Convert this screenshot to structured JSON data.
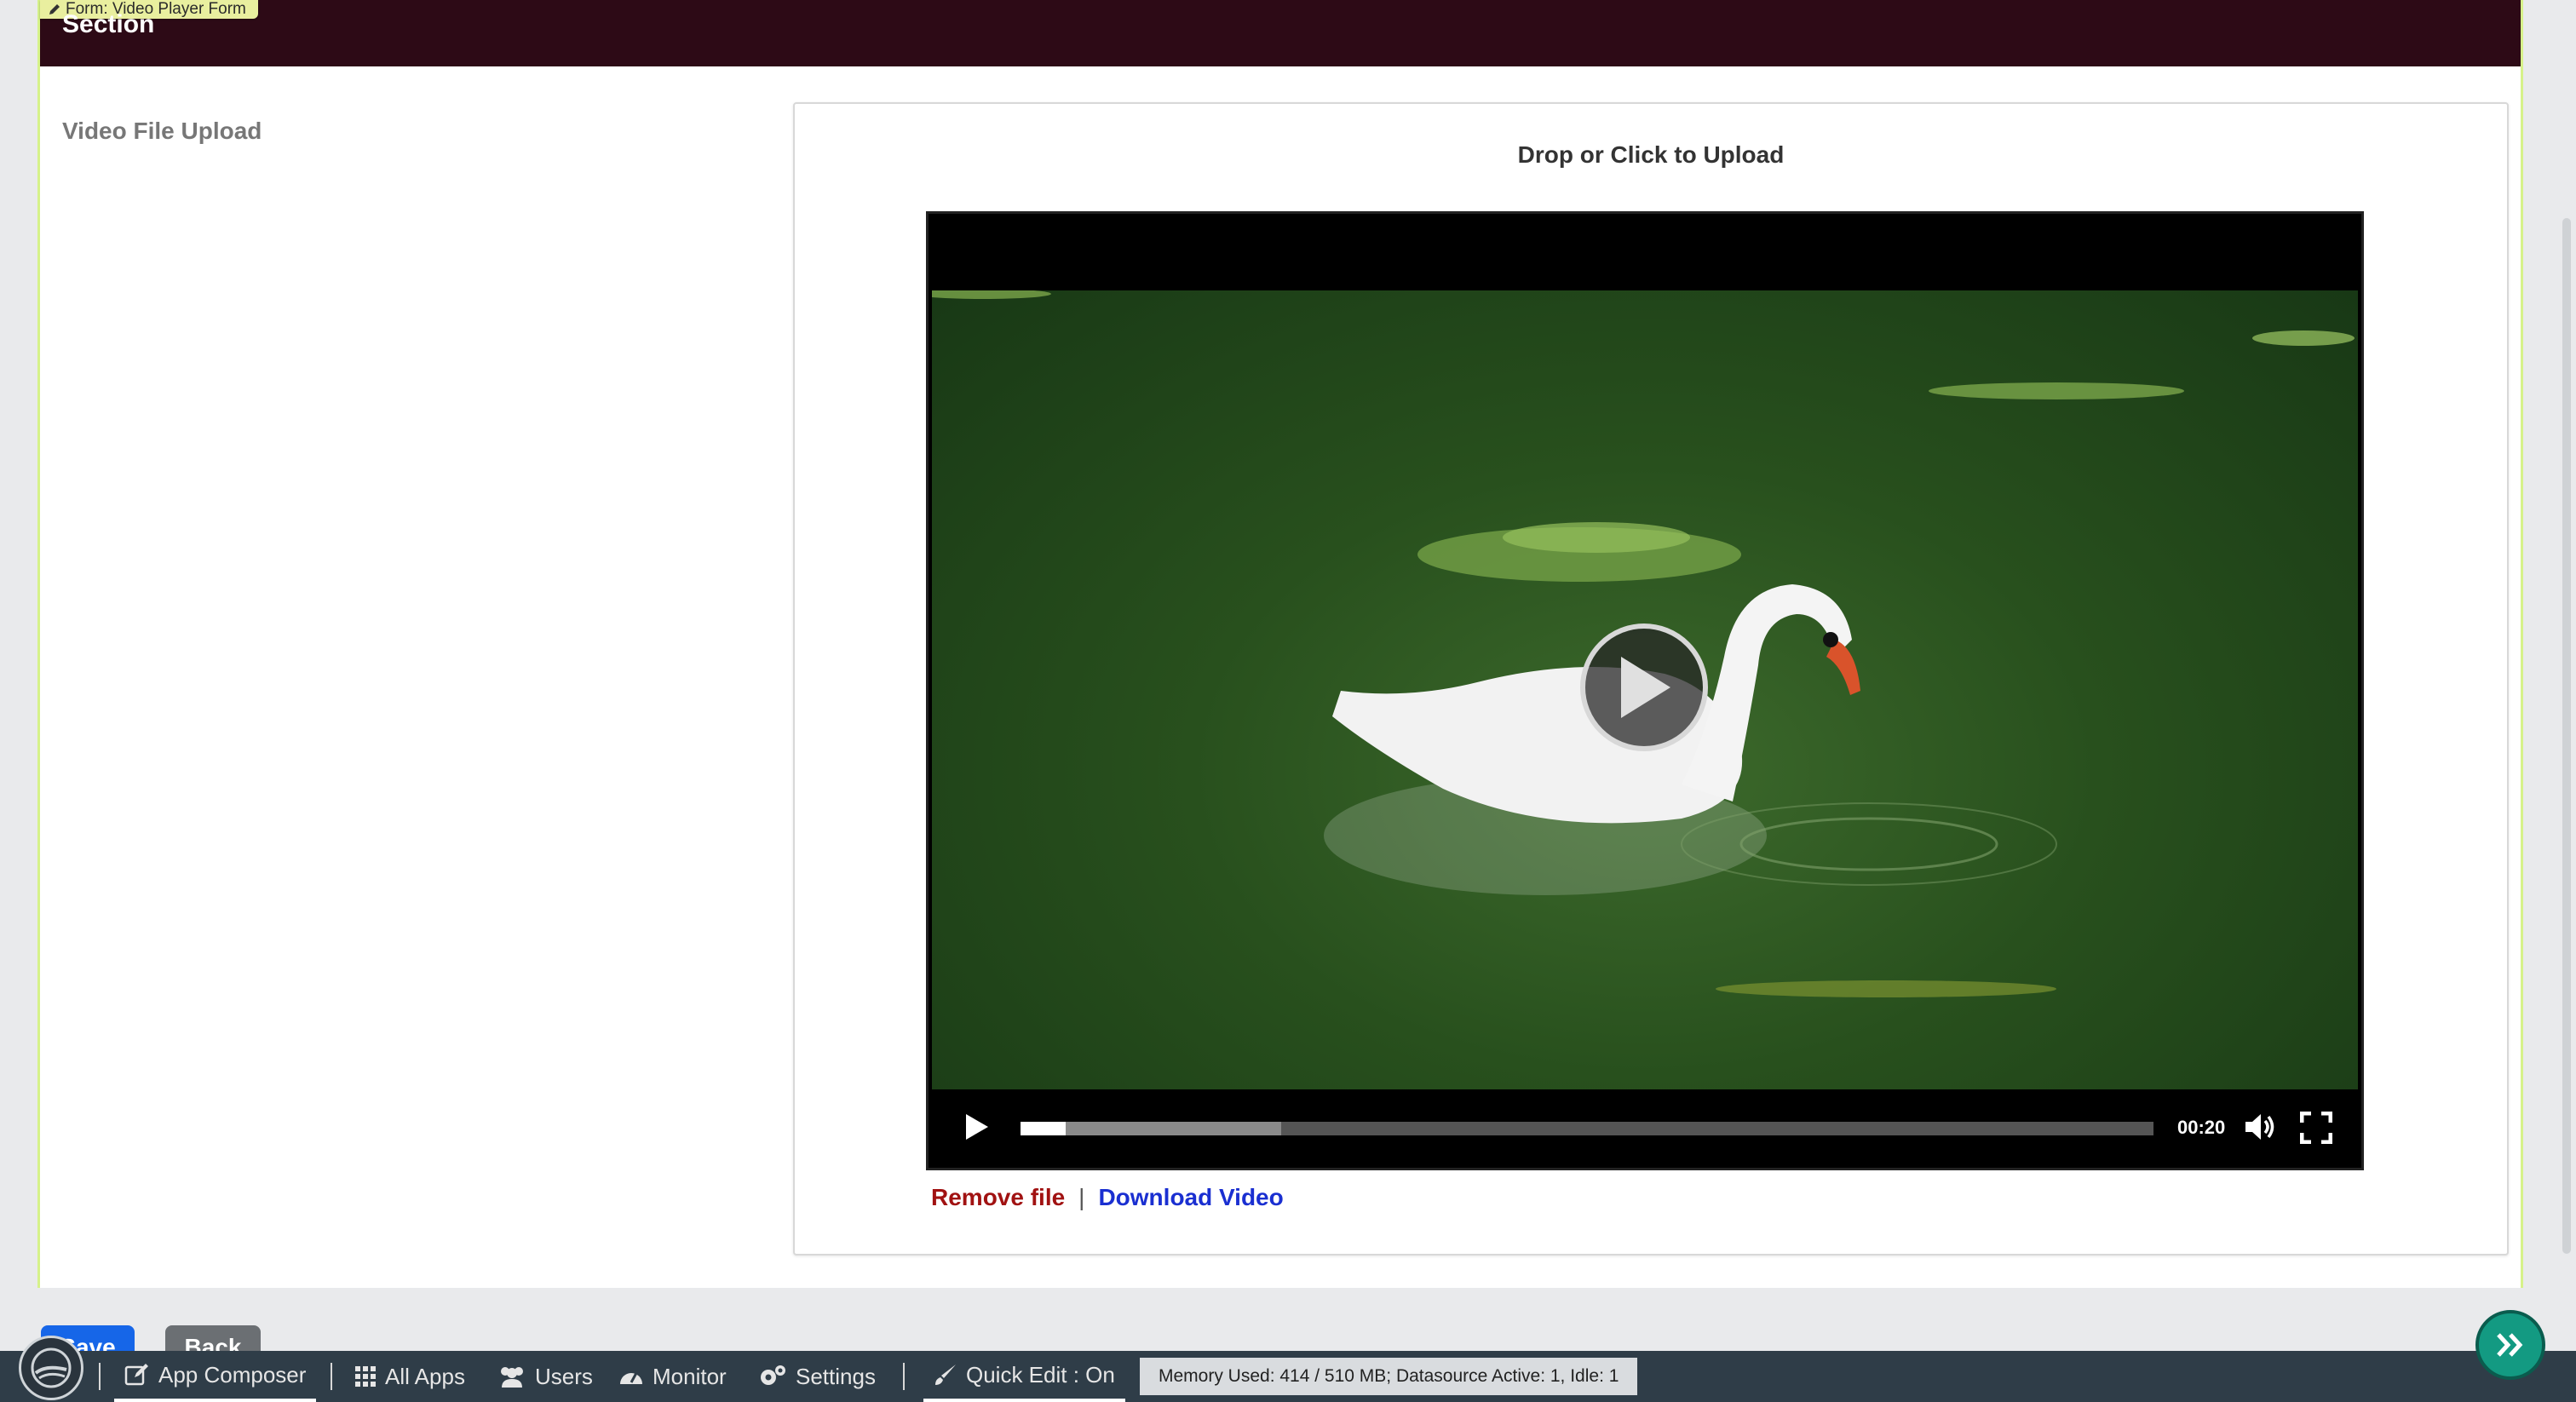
{
  "form": {
    "tag_label": "Form: Video Player Form",
    "section_title": "Section",
    "field_label": "Video File Upload",
    "upload_title": "Drop or Click to Upload"
  },
  "video": {
    "time": "00:20",
    "progress_fraction": 0.04,
    "buffered_fraction": 0.23
  },
  "file_links": {
    "remove_label": "Remove file",
    "separator": "|",
    "download_label": "Download Video"
  },
  "buttons": {
    "save_label": "Save",
    "back_label": "Back"
  },
  "taskbar": {
    "items": [
      {
        "label": "App Composer",
        "icon": "edit-icon",
        "active": true
      },
      {
        "label": "All Apps",
        "icon": "grid-icon"
      },
      {
        "label": "Users",
        "icon": "users-icon"
      },
      {
        "label": "Monitor",
        "icon": "dashboard-icon"
      },
      {
        "label": "Settings",
        "icon": "gears-icon"
      },
      {
        "label": "Quick Edit : On",
        "icon": "brush-icon"
      }
    ],
    "memory_status": "Memory Used: 414 / 510 MB; Datasource Active: 1, Idle: 1"
  },
  "colors": {
    "header_bg": "#2d0a16",
    "save_button": "#1666e8",
    "taskbar_bg": "#2f3d48",
    "fab_bg": "#139a82",
    "remove_link": "#a11212",
    "download_link": "#1a2fd1"
  }
}
